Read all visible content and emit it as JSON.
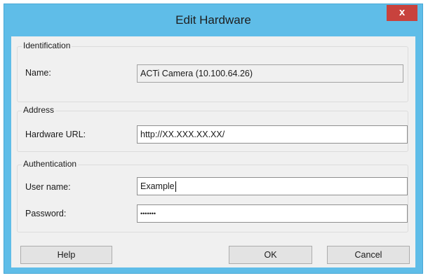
{
  "window": {
    "title": "Edit Hardware",
    "close_glyph": "x"
  },
  "identification": {
    "legend": "Identification",
    "name_label": "Name:",
    "name_value": "ACTi Camera (10.100.64.26)"
  },
  "address": {
    "legend": "Address",
    "url_label": "Hardware URL:",
    "url_value": "http://XX.XXX.XX.XX/"
  },
  "authentication": {
    "legend": "Authentication",
    "username_label": "User name:",
    "username_value": "Example",
    "password_label": "Password:",
    "password_value": "•••••••"
  },
  "buttons": {
    "help": "Help",
    "ok": "OK",
    "cancel": "Cancel"
  },
  "colors": {
    "titlebar": "#5fbde8",
    "close": "#c8423d",
    "client": "#f0f0f0"
  }
}
